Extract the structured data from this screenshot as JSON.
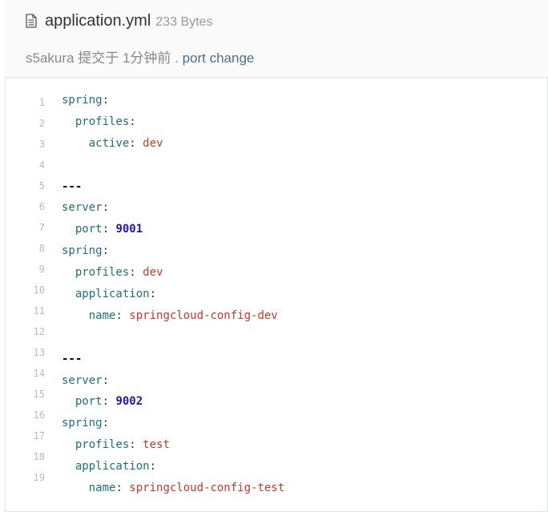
{
  "file": {
    "name": "application.yml",
    "size": "233 Bytes",
    "icon": "file-text-icon"
  },
  "commit": {
    "author": "s5akura",
    "action": " 提交于 ",
    "time": "1分钟前",
    "separator": " . ",
    "message": "port change"
  },
  "line_numbers": [
    "1",
    "2",
    "3",
    "4",
    "5",
    "6",
    "7",
    "8",
    "9",
    "10",
    "11",
    "12",
    "13",
    "14",
    "15",
    "16",
    "17",
    "18",
    "19"
  ],
  "code": [
    {
      "indent": "",
      "key": "spring",
      "colon": ":",
      "value": "",
      "vtype": ""
    },
    {
      "indent": "  ",
      "key": "profiles",
      "colon": ":",
      "value": "",
      "vtype": ""
    },
    {
      "indent": "    ",
      "key": "active",
      "colon": ": ",
      "value": "dev",
      "vtype": "s"
    },
    {
      "indent": "",
      "key": "",
      "colon": "",
      "value": "",
      "vtype": ""
    },
    {
      "indent": "",
      "key": "",
      "colon": "",
      "value": "---",
      "vtype": "d"
    },
    {
      "indent": "",
      "key": "server",
      "colon": ":",
      "value": "",
      "vtype": ""
    },
    {
      "indent": "  ",
      "key": "port",
      "colon": ": ",
      "value": "9001",
      "vtype": "n"
    },
    {
      "indent": "",
      "key": "spring",
      "colon": ":",
      "value": "",
      "vtype": ""
    },
    {
      "indent": "  ",
      "key": "profiles",
      "colon": ": ",
      "value": "dev",
      "vtype": "s"
    },
    {
      "indent": "  ",
      "key": "application",
      "colon": ":",
      "value": "",
      "vtype": ""
    },
    {
      "indent": "    ",
      "key": "name",
      "colon": ": ",
      "value": "springcloud-config-dev",
      "vtype": "s"
    },
    {
      "indent": "",
      "key": "",
      "colon": "",
      "value": "",
      "vtype": ""
    },
    {
      "indent": "",
      "key": "",
      "colon": "",
      "value": "---",
      "vtype": "d"
    },
    {
      "indent": "",
      "key": "server",
      "colon": ":",
      "value": "",
      "vtype": ""
    },
    {
      "indent": "  ",
      "key": "port",
      "colon": ": ",
      "value": "9002",
      "vtype": "n"
    },
    {
      "indent": "",
      "key": "spring",
      "colon": ":",
      "value": "",
      "vtype": ""
    },
    {
      "indent": "  ",
      "key": "profiles",
      "colon": ": ",
      "value": "test",
      "vtype": "s"
    },
    {
      "indent": "  ",
      "key": "application",
      "colon": ":",
      "value": "",
      "vtype": ""
    },
    {
      "indent": "    ",
      "key": "name",
      "colon": ": ",
      "value": "springcloud-config-test",
      "vtype": "s"
    }
  ],
  "colors": {
    "key": "#1f6f7a",
    "string": "#c23a2b",
    "number": "#1a1aa6",
    "link": "#4a6f93"
  }
}
